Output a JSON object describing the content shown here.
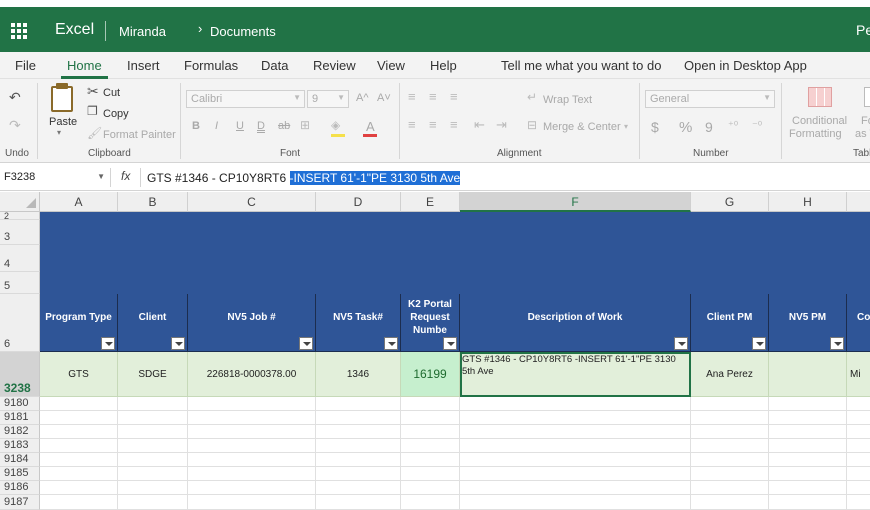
{
  "app": {
    "name": "Excel",
    "breadcrumb_owner": "Miranda",
    "breadcrumb_folder": "Documents",
    "user_truncated": "Pe",
    "brand_color": "#217346"
  },
  "menu": {
    "items": [
      "File",
      "Home",
      "Insert",
      "Formulas",
      "Data",
      "Review",
      "View",
      "Help",
      "Tell me what you want to do",
      "Open in Desktop App"
    ],
    "active": "Home"
  },
  "ribbon": {
    "undo_label": "Undo",
    "paste_label": "Paste",
    "cut_label": "Cut",
    "copy_label": "Copy",
    "format_painter_label": "Format Painter",
    "clipboard_label": "Clipboard",
    "font_name": "Calibri",
    "font_size": "9",
    "font_label": "Font",
    "wrap_text_label": "Wrap Text",
    "merge_center_label": "Merge & Center",
    "alignment_label": "Alignment",
    "number_format": "General",
    "number_label": "Number",
    "conditional_label_1": "Conditional",
    "conditional_label_2": "Formatting",
    "format_as_label_1": "Fo",
    "format_as_label_2": "as T",
    "tables_label": "Tabl",
    "bold_glyph": "B",
    "italic_glyph": "I",
    "underline_glyph": "U",
    "double_underline_glyph": "D",
    "strike_glyph": "ab",
    "currency_glyph": "$",
    "percent_glyph": "%",
    "comma_glyph": "9",
    "font_grow_glyph": "A^",
    "font_shrink_glyph": "A˅",
    "font_color_glyph": "A"
  },
  "formula_bar": {
    "cell_ref": "F3238",
    "fx": "fx",
    "text_plain": "GTS #1346 - CP10Y8RT6 ",
    "text_selected": "-INSERT 61'-1\"PE 3130 5th Ave"
  },
  "columns": [
    "A",
    "B",
    "C",
    "D",
    "E",
    "F",
    "G",
    "H",
    ""
  ],
  "selected_column": "F",
  "rows_top": [
    "2",
    "3",
    "4",
    "5",
    "6"
  ],
  "selected_row": "3238",
  "rows_bottom": [
    "9180",
    "9181",
    "9182",
    "9183",
    "9184",
    "9185",
    "9186",
    "9187"
  ],
  "table_headers": [
    "Program Type",
    "Client",
    "NV5 Job #",
    "NV5 Task#",
    "K2 Portal Request Numbe",
    "Description of Work",
    "Client PM",
    "NV5 PM",
    "Co"
  ],
  "record": {
    "program_type": "GTS",
    "client": "SDGE",
    "job": "226818-0000378.00",
    "task": "1346",
    "k2": "16199",
    "description": "GTS #1346 - CP10Y8RT6 -INSERT 61'-1\"PE 3130 5th Ave",
    "client_pm": "Ana Perez",
    "nv5_pm": "",
    "co_truncated": "Mi"
  }
}
